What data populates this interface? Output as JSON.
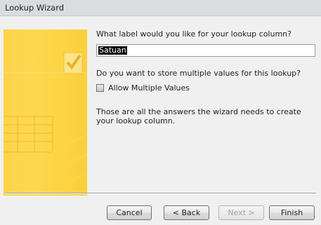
{
  "window": {
    "title": "Lookup Wizard"
  },
  "questions": {
    "label_prompt": "What label would you like for your lookup column?",
    "label_value": "Satuan",
    "multi_prompt": "Do you want to store multiple values for this lookup?",
    "allow_multiple_label": "Allow Multiple Values",
    "allow_multiple_checked": false,
    "final_note": "Those are all the answers the wizard needs to create your lookup column."
  },
  "buttons": {
    "cancel": "Cancel",
    "back": "< Back",
    "next": "Next >",
    "finish": "Finish"
  },
  "icons": {
    "wizard_art": "table-checkmark-illustration",
    "checkbox": "checkbox-unchecked"
  },
  "colors": {
    "art_background": "#fcd34a",
    "window_background": "#f0f0f0"
  }
}
